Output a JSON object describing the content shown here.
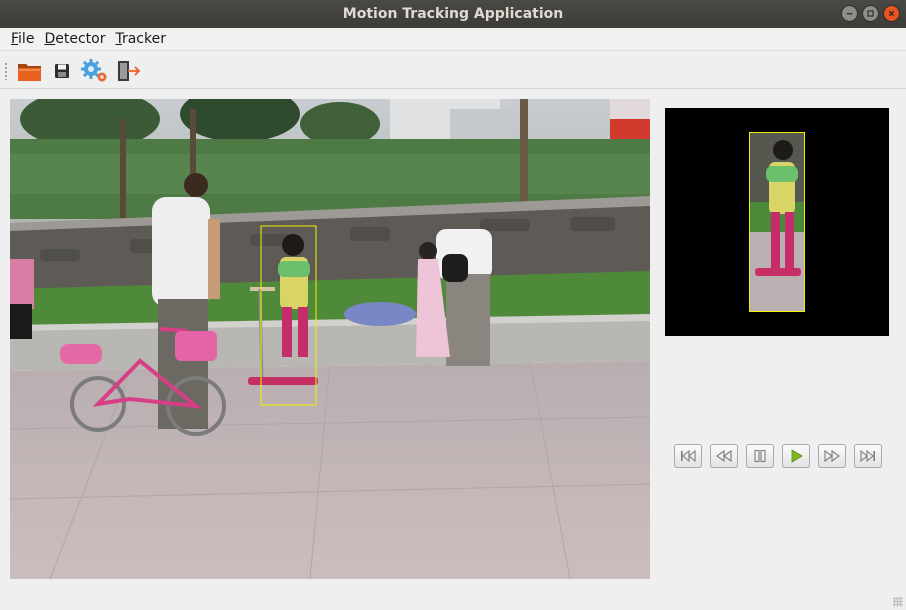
{
  "window": {
    "title": "Motion Tracking Application"
  },
  "menu": [
    {
      "label": "File",
      "accel": "F",
      "rest": "ile"
    },
    {
      "label": "Detector",
      "accel": "D",
      "rest": "etector"
    },
    {
      "label": "Tracker",
      "accel": "T",
      "rest": "racker"
    }
  ],
  "toolbar": {
    "icons": [
      "open-folder-icon",
      "save-icon",
      "settings-gears-icon",
      "exit-icon"
    ]
  },
  "video": {
    "tracking_box_color": "#f4f000"
  },
  "playback": {
    "buttons": [
      "skip-to-start-icon",
      "rewind-icon",
      "pause-icon",
      "play-icon",
      "fast-forward-icon",
      "skip-to-end-icon"
    ],
    "play_color": "#7cbb1f"
  },
  "colors": {
    "titlebar": "#3c3b37",
    "close_button": "#e95420",
    "window_bg": "#efefef"
  }
}
